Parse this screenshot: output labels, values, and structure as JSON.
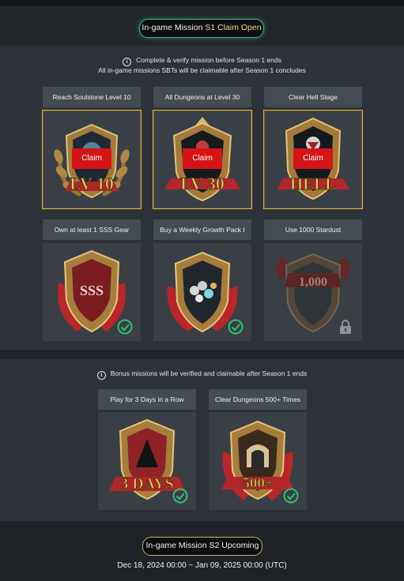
{
  "s1_header": {
    "prefix": "In-game Mission",
    "highlight": "S1 Claim Open"
  },
  "s1_info": {
    "line1": "Complete & verify mission before Season 1 ends",
    "line2": "All in-game missions SBTs will be claimable after Season 1 concludes"
  },
  "missions": [
    {
      "label": "Reach Soulstone Level 10",
      "badge_text": "LV 10",
      "status": "claimable",
      "button": "Claim"
    },
    {
      "label": "All Dungeons at Level 30",
      "badge_text": "LV 30",
      "status": "claimable",
      "button": "Claim"
    },
    {
      "label": "Clear Hell Stage",
      "badge_text": "HELL",
      "status": "claimable",
      "button": "Claim"
    },
    {
      "label": "Own at least 1 SSS Gear",
      "badge_text": "SSS",
      "status": "completed"
    },
    {
      "label": "Buy a Weekly Growth Pack I",
      "badge_text": "",
      "status": "completed"
    },
    {
      "label": "Use 1000 Stardust",
      "badge_text": "1,000",
      "status": "locked"
    }
  ],
  "bonus_info": "Bonus missions will be verified and claimable after Season 1 ends",
  "bonus_missions": [
    {
      "label": "Play for 3 Days in a Row",
      "badge_text": "3 DAYS",
      "status": "completed"
    },
    {
      "label": "Clear Dungeons 500+ Times",
      "badge_text": "500+",
      "status": "completed"
    }
  ],
  "s2_header": {
    "text": "In-game Mission S2 Upcoming"
  },
  "s2_dates": "Dec 18, 2024 00:00 ~ Jan 09, 2025 00:00 (UTC)",
  "colors": {
    "accent_red": "#d51416",
    "gold": "#d8b35a",
    "check_green": "#2fbf7a",
    "panel": "#2d3238"
  }
}
